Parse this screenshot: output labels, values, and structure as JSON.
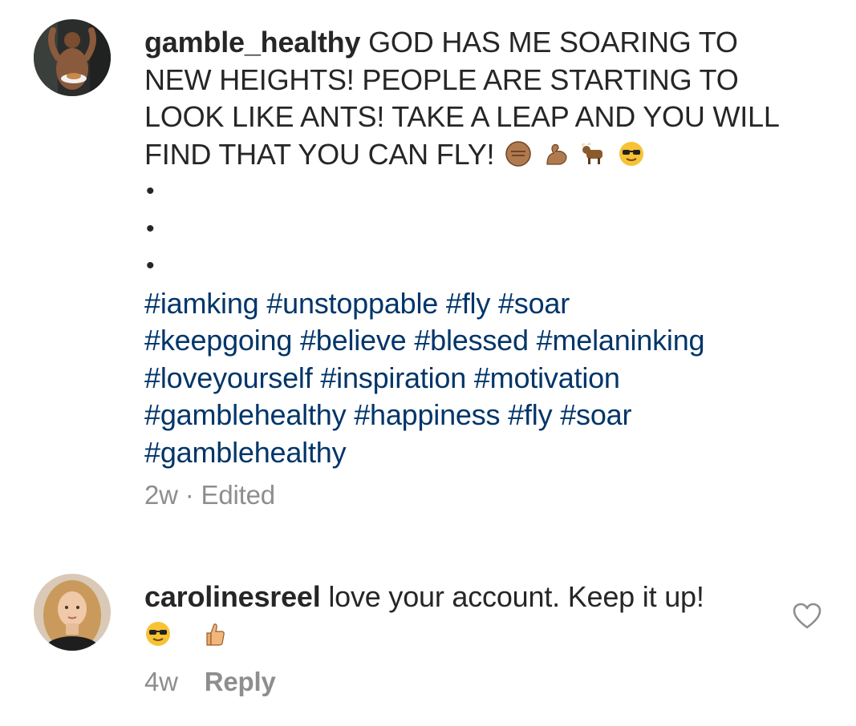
{
  "caption": {
    "username": "gamble_healthy",
    "text": "GOD HAS ME SOARING TO NEW HEIGHTS! PEOPLE ARE STARTING TO LOOK LIKE ANTS! TAKE A  LEAP AND YOU WILL FIND THAT YOU CAN FLY!",
    "emojis": [
      "fist-emoji",
      "flexed-biceps-emoji",
      "ox-emoji",
      "sunglasses-face-emoji"
    ],
    "bullets": [
      "•",
      "•",
      "•"
    ],
    "hashtags": [
      "#iamking",
      "#unstoppable",
      "#fly",
      "#soar",
      "#keepgoing",
      "#believe",
      "#blessed",
      "#melaninking",
      "#loveyourself",
      "#inspiration",
      "#motivation",
      "#gamblehealthy",
      "#happiness",
      "#fly",
      "#soar",
      "#gamblehealthy"
    ],
    "time": "2w",
    "separator": "·",
    "edited": "Edited"
  },
  "reply_comment": {
    "username": "carolinesreel",
    "text": "love your account. Keep it up!",
    "emojis": [
      "sunglasses-face-emoji",
      "thumbs-up-emoji"
    ],
    "time": "4w",
    "reply_label": "Reply",
    "like_icon": "heart-outline-icon"
  },
  "colors": {
    "text": "#262626",
    "hashtag": "#003569",
    "meta": "#8e8e8e",
    "background": "#ffffff"
  }
}
